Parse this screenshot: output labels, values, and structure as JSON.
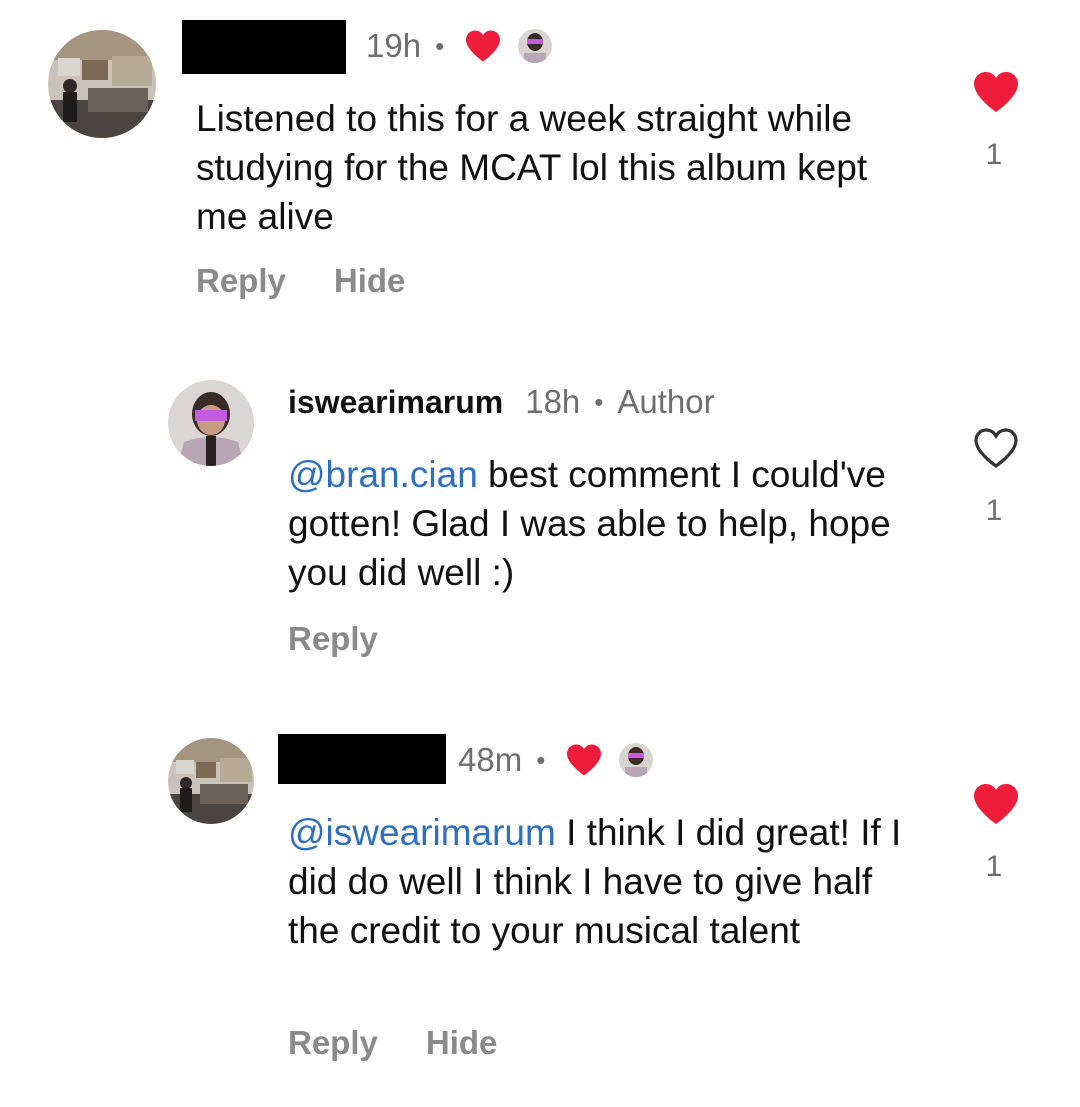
{
  "comments": [
    {
      "time": "19h",
      "separator": "•",
      "text": "Listened to this for a week straight while studying for the MCAT lol this album kept me alive",
      "reply_label": "Reply",
      "hide_label": "Hide",
      "like_count": "1",
      "liked": true
    },
    {
      "username": "iswearimarum",
      "time": "18h",
      "separator": "•",
      "badge": "Author",
      "mention": "@bran.cian",
      "text": " best comment I could've gotten! Glad I was able to help, hope you did well :)",
      "reply_label": "Reply",
      "like_count": "1",
      "liked": false
    },
    {
      "time": "48m",
      "separator": "•",
      "mention": "@iswearimarum",
      "text": " I think I did great! If I did do well I think I have to give half the credit to your musical talent",
      "reply_label": "Reply",
      "hide_label": "Hide",
      "like_count": "1",
      "liked": true
    }
  ],
  "colors": {
    "heart_red": "#ed1c3b",
    "mention_blue": "#2f6fbf",
    "muted_gray": "#8a8a8a"
  },
  "icons": {
    "liked": "heart-filled-icon",
    "unliked": "heart-outline-icon"
  }
}
